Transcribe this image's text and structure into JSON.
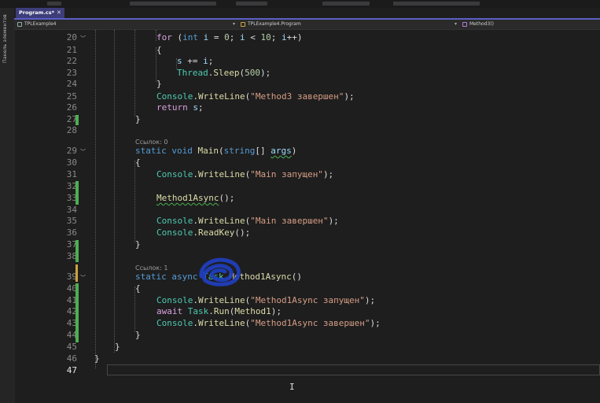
{
  "sidebar": {
    "label": "Панель элементов"
  },
  "tabs": [
    {
      "label": "Program.cs*",
      "active": true
    }
  ],
  "navbar": {
    "project": "TPLExample4",
    "class": "TPLExample4.Program",
    "member": "Method3()"
  },
  "code_lens": [
    {
      "text": "Ссылок: 0"
    },
    {
      "text": "Ссылок: 1"
    }
  ],
  "lines": [
    {
      "number": "20",
      "code": "for (int i = 0; i < 10; i++)"
    },
    {
      "number": "21",
      "code": "{"
    },
    {
      "number": "22",
      "code": "s += i;"
    },
    {
      "number": "23",
      "code": "Thread.Sleep(500);"
    },
    {
      "number": "24",
      "code": "}"
    },
    {
      "number": "25",
      "code": "Console.WriteLine(\"Method3 завершен\");"
    },
    {
      "number": "26",
      "code": "return s;"
    },
    {
      "number": "27",
      "code": "}"
    },
    {
      "number": "28",
      "code": ""
    },
    {
      "number": "29",
      "code": "static void Main(string[] args)"
    },
    {
      "number": "30",
      "code": "{"
    },
    {
      "number": "31",
      "code": "Console.WriteLine(\"Main запущен\");"
    },
    {
      "number": "32",
      "code": ""
    },
    {
      "number": "33",
      "code": "Method1Async();"
    },
    {
      "number": "34",
      "code": ""
    },
    {
      "number": "35",
      "code": "Console.WriteLine(\"Main завершен\");"
    },
    {
      "number": "36",
      "code": "Console.ReadKey();"
    },
    {
      "number": "37",
      "code": "}"
    },
    {
      "number": "38",
      "code": ""
    },
    {
      "number": "39",
      "code": "static async Task Method1Async()"
    },
    {
      "number": "40",
      "code": "{"
    },
    {
      "number": "41",
      "code": "Console.WriteLine(\"Method1Async запущен\");"
    },
    {
      "number": "42",
      "code": "await Task.Run(Method1);"
    },
    {
      "number": "43",
      "code": "Console.WriteLine(\"Method1Async завершен\");"
    },
    {
      "number": "44",
      "code": "}"
    },
    {
      "number": "45",
      "code": "}"
    },
    {
      "number": "46",
      "code": "}"
    },
    {
      "number": "47",
      "code": ""
    }
  ],
  "colors": {
    "keyword": "#569cd6",
    "type": "#4ec9b0",
    "method": "#dcdcaa",
    "string": "#d69d85",
    "number": "#b5cea8",
    "change_marker": "#4caf50",
    "annotation": "#1f3fbf"
  }
}
